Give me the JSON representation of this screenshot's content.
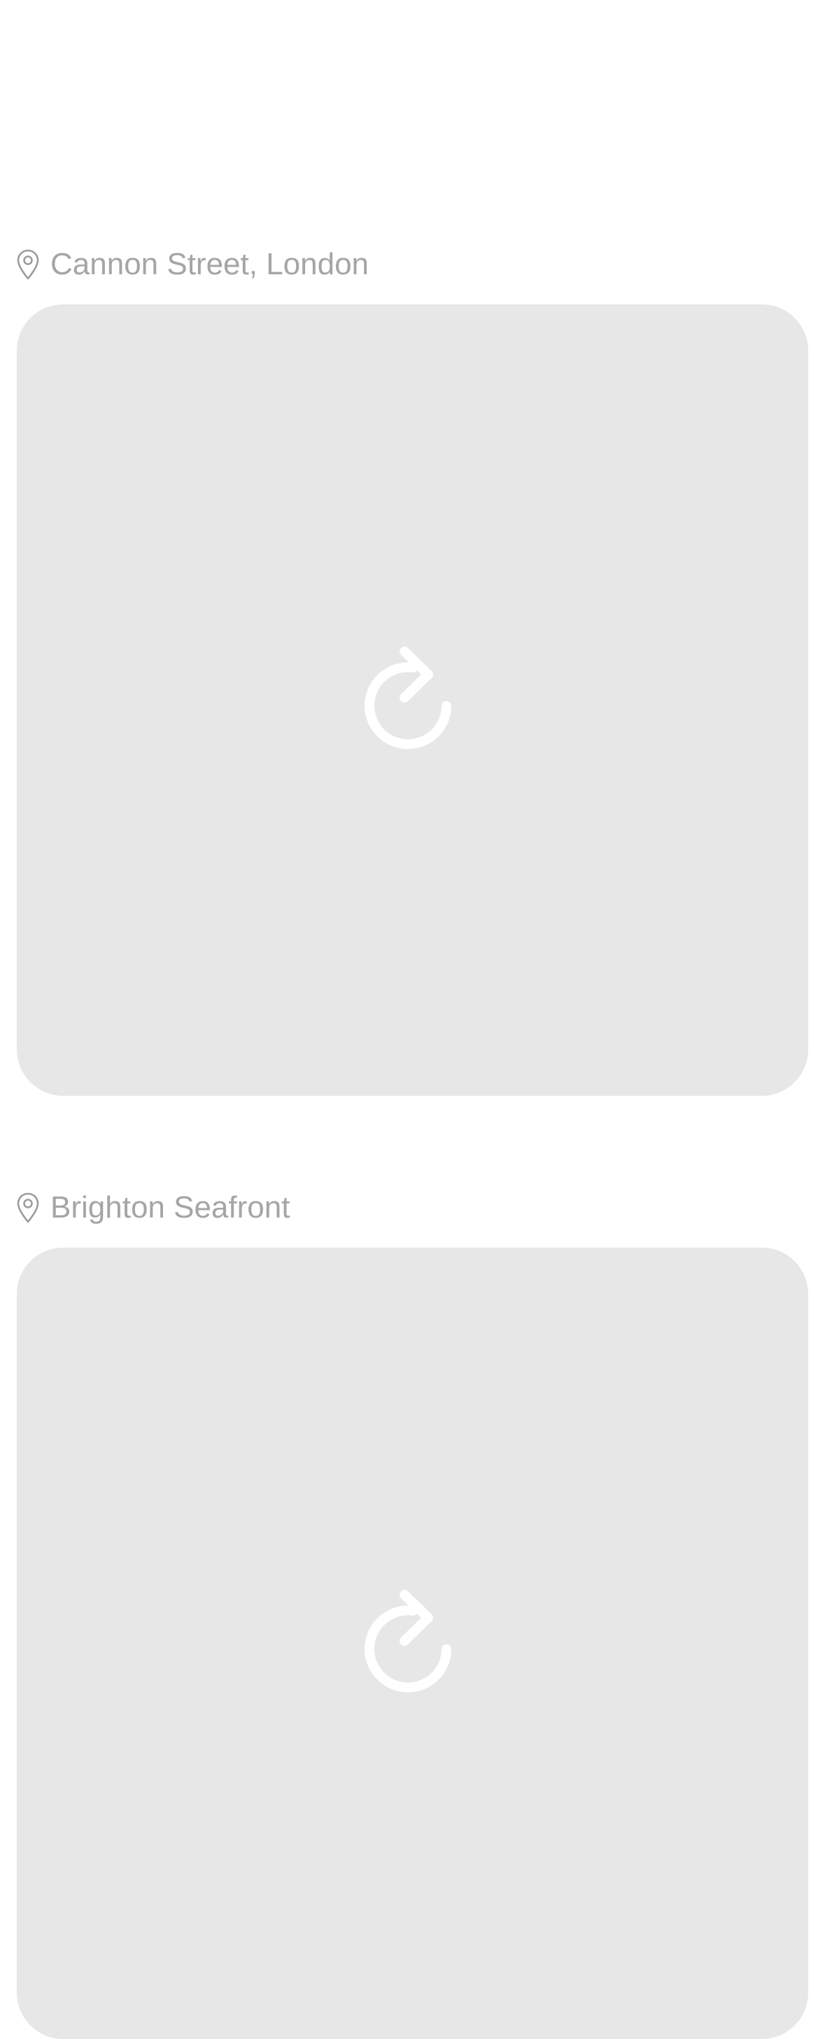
{
  "posts": [
    {
      "location": "Cannon Street, London",
      "location_icon": "map-pin-icon",
      "image_state_icon": "reload-icon"
    },
    {
      "location": "Brighton Seafront",
      "location_icon": "map-pin-icon",
      "image_state_icon": "reload-icon"
    }
  ],
  "colors": {
    "label": "#a5a5a8",
    "placeholder_bg": "#e7e7e8",
    "icon_stroke": "#ffffff",
    "pin_stroke": "#9c9ca0"
  }
}
